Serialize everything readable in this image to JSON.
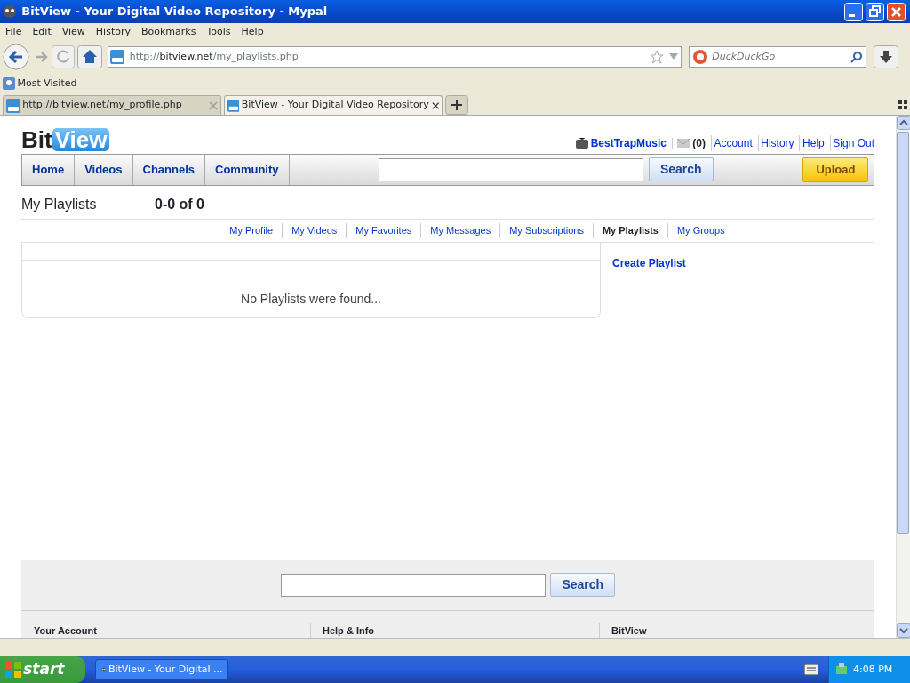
{
  "window": {
    "title": "BitView - Your Digital Video Repository - Mypal"
  },
  "menu": [
    "File",
    "Edit",
    "View",
    "History",
    "Bookmarks",
    "Tools",
    "Help"
  ],
  "address": {
    "scheme": "http://",
    "host": "bitview.net",
    "path": "/my_playlists.php"
  },
  "web_search": {
    "placeholder": "DuckDuckGo"
  },
  "bookmarks": [
    "Most Visited"
  ],
  "tabs": [
    {
      "label": "http://bitview.net/my_profile.php",
      "selected": false
    },
    {
      "label": "BitView - Your Digital Video Repository",
      "selected": true
    }
  ],
  "page": {
    "logo": {
      "left": "Bit",
      "right": "View"
    },
    "user": {
      "name": "BestTrapMusic",
      "messages": "(0)",
      "links": [
        "Account",
        "History",
        "Help",
        "Sign Out"
      ]
    },
    "nav": [
      "Home",
      "Videos",
      "Channels",
      "Community"
    ],
    "search_button": "Search",
    "upload_button": "Upload",
    "heading": "My Playlists",
    "count": "0-0 of 0",
    "subnav": [
      {
        "label": "My Profile",
        "selected": false
      },
      {
        "label": "My Videos",
        "selected": false
      },
      {
        "label": "My Favorites",
        "selected": false
      },
      {
        "label": "My Messages",
        "selected": false
      },
      {
        "label": "My Subscriptions",
        "selected": false
      },
      {
        "label": "My Playlists",
        "selected": true
      },
      {
        "label": "My Groups",
        "selected": false
      }
    ],
    "empty_message": "No Playlists were found...",
    "side_link": "Create Playlist",
    "footer": {
      "search_button": "Search",
      "columns": [
        "Your Account",
        "Help & Info",
        "BitView"
      ]
    }
  },
  "taskbar": {
    "start": "start",
    "tasks": [
      "BitView - Your Digital ..."
    ],
    "clock": "4:08 PM"
  }
}
